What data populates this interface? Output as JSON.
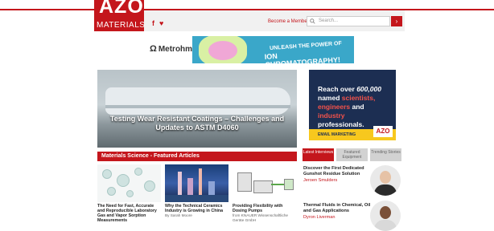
{
  "header": {
    "logo_top": "AZO",
    "logo_bottom": "MATERIALS",
    "social": [
      "f",
      "♥"
    ],
    "member_link": "Become a Member",
    "search_placeholder": "Search...",
    "search_button": "›"
  },
  "ads": {
    "top_brand": "Metrohm",
    "top_line1": "UNLEASH THE POWER OF",
    "top_line2": "ION CHROMATOGRAPHY!",
    "right_text_a": "Reach over ",
    "right_count": "600,000",
    "right_text_b": "named ",
    "right_red1": "scientists,",
    "right_red2": "engineers",
    "right_text_c": " and ",
    "right_red3": "industry",
    "right_text_d": "professionals.",
    "right_strip": "EMAIL MARKETING",
    "right_logo": "AZO"
  },
  "hero": {
    "caption": "Testing Wear Resistant Coatings – Challenges and Updates to ASTM D4060"
  },
  "featured": {
    "heading": "Materials Science - Featured Articles",
    "articles": [
      {
        "title": "The Need for Fast, Accurate and Reproducible Laboratory Gas and Vapor Sorption Measurements",
        "by": ""
      },
      {
        "title": "Why the Technical Ceramics Industry is Growing in China",
        "by": "By Sarah Moore"
      },
      {
        "title": "Providing Flexibility with Dosing Pumps",
        "by": "from KNAUER Wissenschaftliche Geräte GmbH"
      }
    ]
  },
  "sidebar": {
    "tabs": [
      {
        "label": "Latest Interviews",
        "active": true
      },
      {
        "label": "Featured Equipment",
        "active": false
      },
      {
        "label": "Trending Stories",
        "active": false
      }
    ],
    "interviews": [
      {
        "title": "Discover the First Dedicated Gunshot Residue Solution",
        "author": "Jeroen Smulders"
      },
      {
        "title": "Thermal Fluids in Chemical, Oil and Gas Applications",
        "author": "Dyron Liverman"
      }
    ]
  },
  "colors": {
    "brand": "#c4161c",
    "ad_navy": "#1c2e52",
    "ad_yellow": "#f7c81e"
  }
}
